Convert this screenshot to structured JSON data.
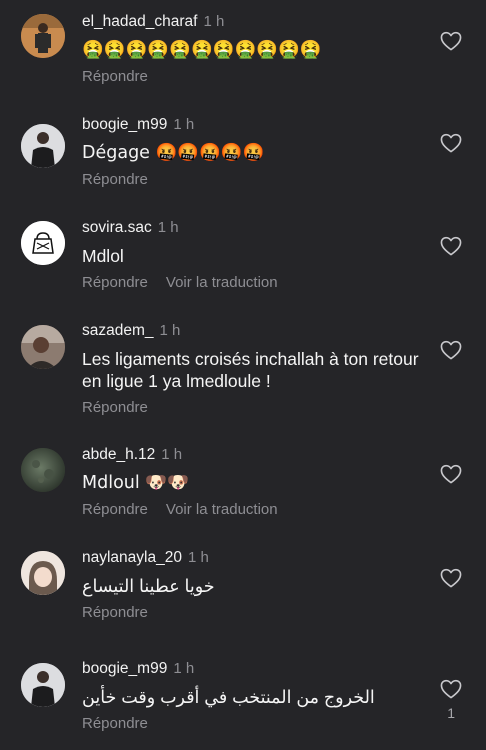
{
  "comments": [
    {
      "username": "el_hadad_charaf",
      "time": "1 h",
      "text": "🤮🤮🤮🤮🤮🤮🤮🤮🤮🤮🤮",
      "reply_label": "Répondre",
      "avatar_color": "#b77a44"
    },
    {
      "username": "boogie_m99",
      "time": "1 h",
      "text": "Dégage 🤬🤬🤬🤬🤬",
      "reply_label": "Répondre",
      "avatar_color": "#d9dadd"
    },
    {
      "username": "sovira.sac",
      "time": "1 h",
      "text": "Mdlol",
      "reply_label": "Répondre",
      "translate_label": "Voir la traduction",
      "avatar_color": "#ffffff"
    },
    {
      "username": "sazadem_",
      "time": "1 h",
      "text": "Les ligaments croisés inchallah à ton retour en ligue 1 ya lmedloule !",
      "reply_label": "Répondre",
      "avatar_color": "#7a6a62"
    },
    {
      "username": "abde_h.12",
      "time": "1 h",
      "text": "Mdloul 🐶🐶",
      "reply_label": "Répondre",
      "translate_label": "Voir la traduction",
      "avatar_color": "#3b4538"
    },
    {
      "username": "naylanayla_20",
      "time": "1 h",
      "text": "خويا عطينا التيساع",
      "reply_label": "Répondre",
      "avatar_color": "#e8ddd5"
    },
    {
      "username": "boogie_m99",
      "time": "1 h",
      "text": "الخروج من المنتخب في أقرب وقت خأين",
      "reply_label": "Répondre",
      "like_count": "1",
      "avatar_color": "#d9dadd"
    }
  ]
}
